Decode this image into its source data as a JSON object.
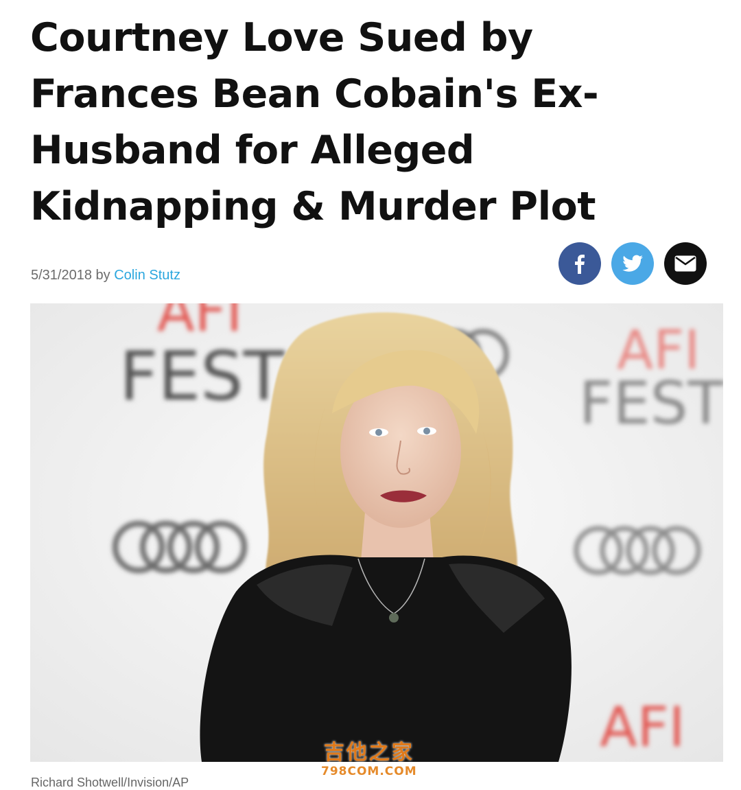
{
  "article": {
    "headline": "Courtney Love Sued by Frances Bean Cobain's Ex-Husband for Alleged Kidnapping & Murder Plot",
    "date": "5/31/2018",
    "by": "by",
    "author": "Colin Stutz",
    "photo_credit": "Richard Shotwell/Invision/AP"
  },
  "share": {
    "facebook_icon": "facebook-icon",
    "twitter_icon": "twitter-icon",
    "email_icon": "mail-icon",
    "colors": {
      "facebook": "#3b5998",
      "twitter": "#4aa8e6",
      "email": "#111111"
    }
  },
  "photo": {
    "backdrop_texts": [
      "AFI",
      "FEST"
    ]
  },
  "watermark": {
    "main": "吉他之家",
    "sub": "798COM.COM"
  },
  "colors": {
    "author_link": "#2aa6de",
    "afi_red": "#e25a55"
  }
}
